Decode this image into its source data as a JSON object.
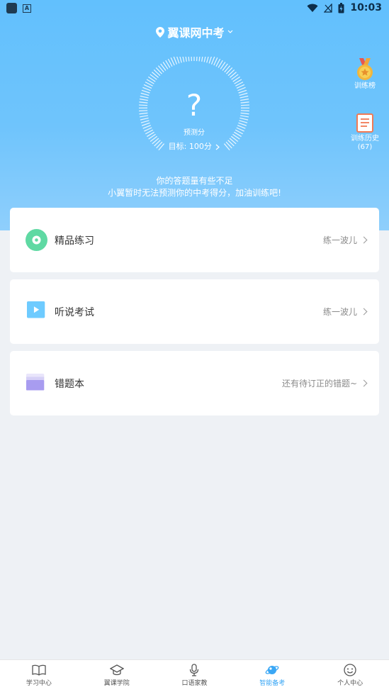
{
  "status_bar": {
    "time": "10:03"
  },
  "header": {
    "title": "翼课网中考"
  },
  "gauge": {
    "symbol": "?",
    "label": "预测分",
    "target": "目标: 100分"
  },
  "side": {
    "rank_label": "训练榜",
    "history_label": "训练历史",
    "history_count": "(67)"
  },
  "hint": {
    "line1": "你的答题量有些不足",
    "line2": "小翼暂时无法预测你的中考得分，加油训练吧!"
  },
  "cards": [
    {
      "title": "精品练习",
      "action": "练一波儿"
    },
    {
      "title": "听说考试",
      "action": "练一波儿"
    },
    {
      "title": "错题本",
      "action": "还有待订正的错题~"
    }
  ],
  "nav": [
    {
      "label": "学习中心"
    },
    {
      "label": "翼课学院"
    },
    {
      "label": "口语家教"
    },
    {
      "label": "智能备考"
    },
    {
      "label": "个人中心"
    }
  ],
  "colors": {
    "accent": "#3aa7f5",
    "hero_top": "#62c0fd",
    "card_icon_green": "#5fd9a3",
    "card_icon_blue": "#6ecbff",
    "card_icon_purple": "#a89cf0"
  }
}
